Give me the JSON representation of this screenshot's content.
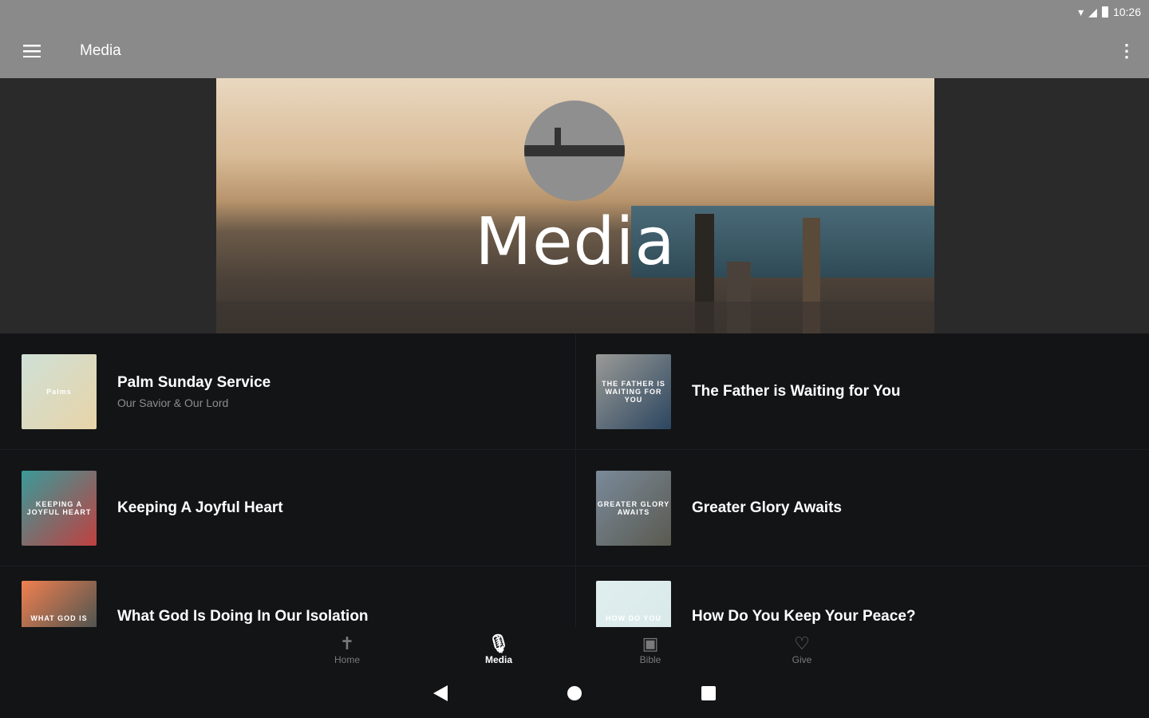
{
  "status_bar": {
    "time": "10:26",
    "icons": [
      "wifi-icon",
      "signal-icon",
      "battery-icon"
    ]
  },
  "app_bar": {
    "title": "Media",
    "menu_icon": "hamburger-menu-icon",
    "more_icon": "more-vert-icon"
  },
  "hero": {
    "title": "Media"
  },
  "media_items": [
    {
      "title": "Palm Sunday Service",
      "subtitle": "Our Savior & Our Lord",
      "thumb_text": "Palms",
      "thumb_colors": [
        "#cfe0d6",
        "#e8d4a8"
      ]
    },
    {
      "title": "The Father is Waiting for You",
      "subtitle": "",
      "thumb_text": "THE FATHER IS WAITING FOR YOU",
      "thumb_colors": [
        "#9a9a96",
        "#2c4660"
      ]
    },
    {
      "title": "Keeping A Joyful Heart",
      "subtitle": "",
      "thumb_text": "KEEPING A JOYFUL HEART",
      "thumb_colors": [
        "#3a9a9a",
        "#c04040"
      ]
    },
    {
      "title": "Greater Glory Awaits",
      "subtitle": "",
      "thumb_text": "GREATER GLORY AWAITS",
      "thumb_colors": [
        "#7a8a9a",
        "#5a5a50"
      ]
    },
    {
      "title": "What God Is Doing In Our Isolation",
      "subtitle": "",
      "thumb_text": "WHAT GOD IS",
      "thumb_colors": [
        "#f08050",
        "#2a4a50"
      ]
    },
    {
      "title": "How Do You Keep Your Peace?",
      "subtitle": "",
      "thumb_text": "HOW DO YOU",
      "thumb_colors": [
        "#e0eef0",
        "#d8e8e8"
      ]
    }
  ],
  "bottom_nav": [
    {
      "label": "Home",
      "icon": "cross-icon",
      "active": false
    },
    {
      "label": "Media",
      "icon": "microphone-icon",
      "active": true
    },
    {
      "label": "Bible",
      "icon": "bible-icon",
      "active": false
    },
    {
      "label": "Give",
      "icon": "heart-icon",
      "active": false
    }
  ],
  "system_nav": [
    "back-icon",
    "home-icon",
    "recents-icon"
  ]
}
